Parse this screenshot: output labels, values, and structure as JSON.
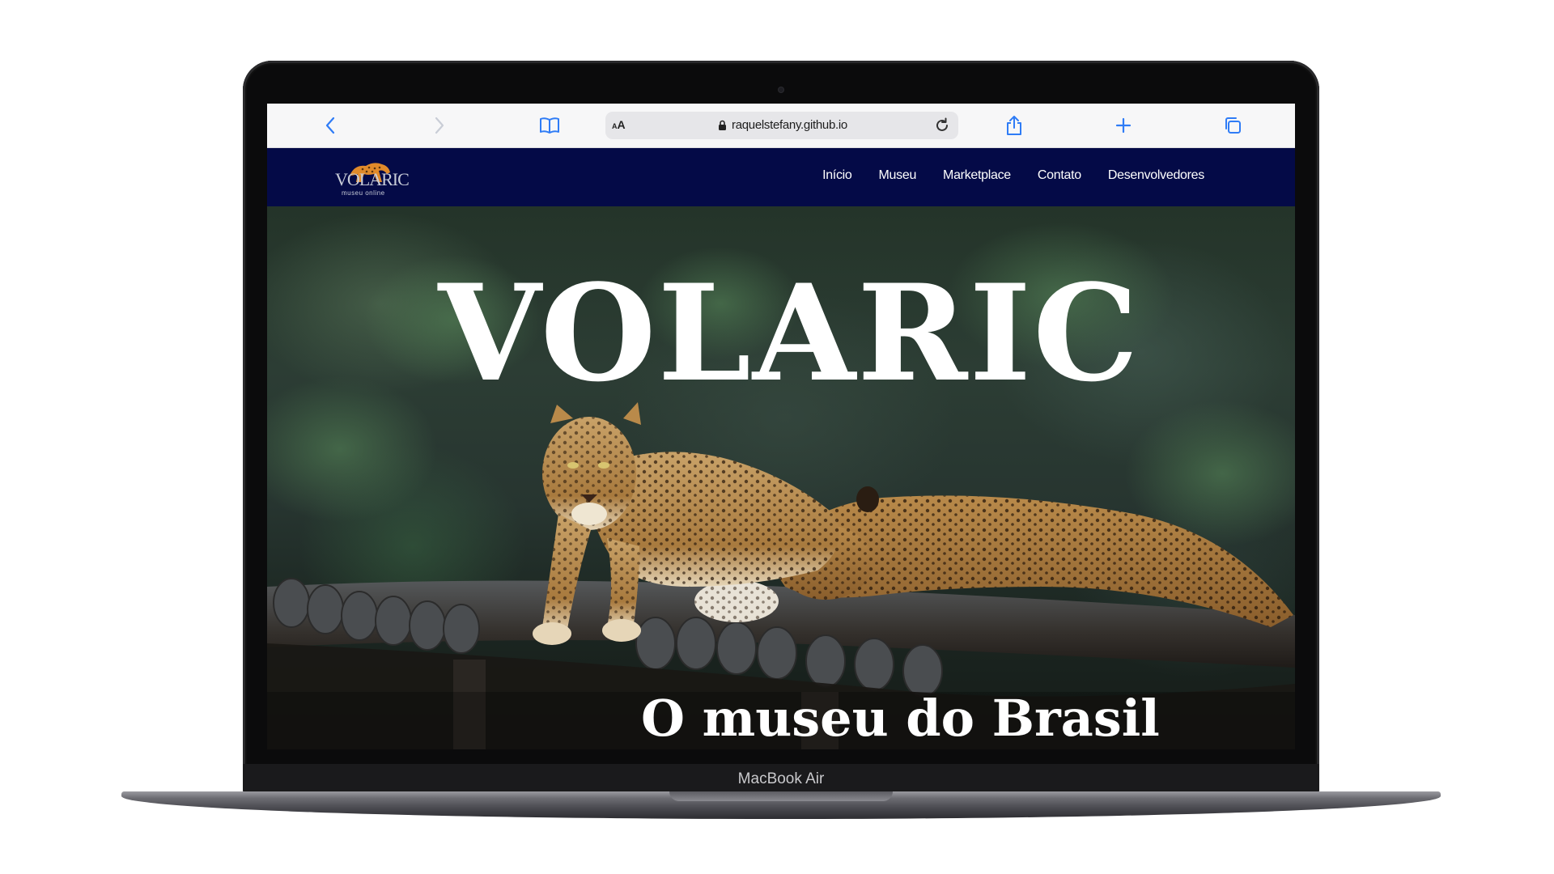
{
  "device": {
    "model_label": "MacBook Air"
  },
  "browser": {
    "url_display": "raquelstefany.github.io",
    "text_size_label": "AA",
    "icons": {
      "back": "chevron-left-icon",
      "forward": "chevron-right-icon",
      "bookmarks": "book-icon",
      "lock": "lock-icon",
      "reload": "reload-icon",
      "share": "share-icon",
      "new_tab": "plus-icon",
      "tabs": "tabs-icon"
    },
    "accent_color": "#2f7cf6"
  },
  "site": {
    "logo_text": "VOLARIC",
    "logo_subtext": "museu online",
    "nav": {
      "items": [
        {
          "label": "Início"
        },
        {
          "label": "Museu"
        },
        {
          "label": "Marketplace"
        },
        {
          "label": "Contato"
        },
        {
          "label": "Desenvolvedores"
        }
      ]
    },
    "nav_background": "#040a47",
    "hero": {
      "title": "VOLARIC",
      "subtitle": "O museu do Brasil",
      "image_subject": "two leopards resting on a log"
    }
  }
}
